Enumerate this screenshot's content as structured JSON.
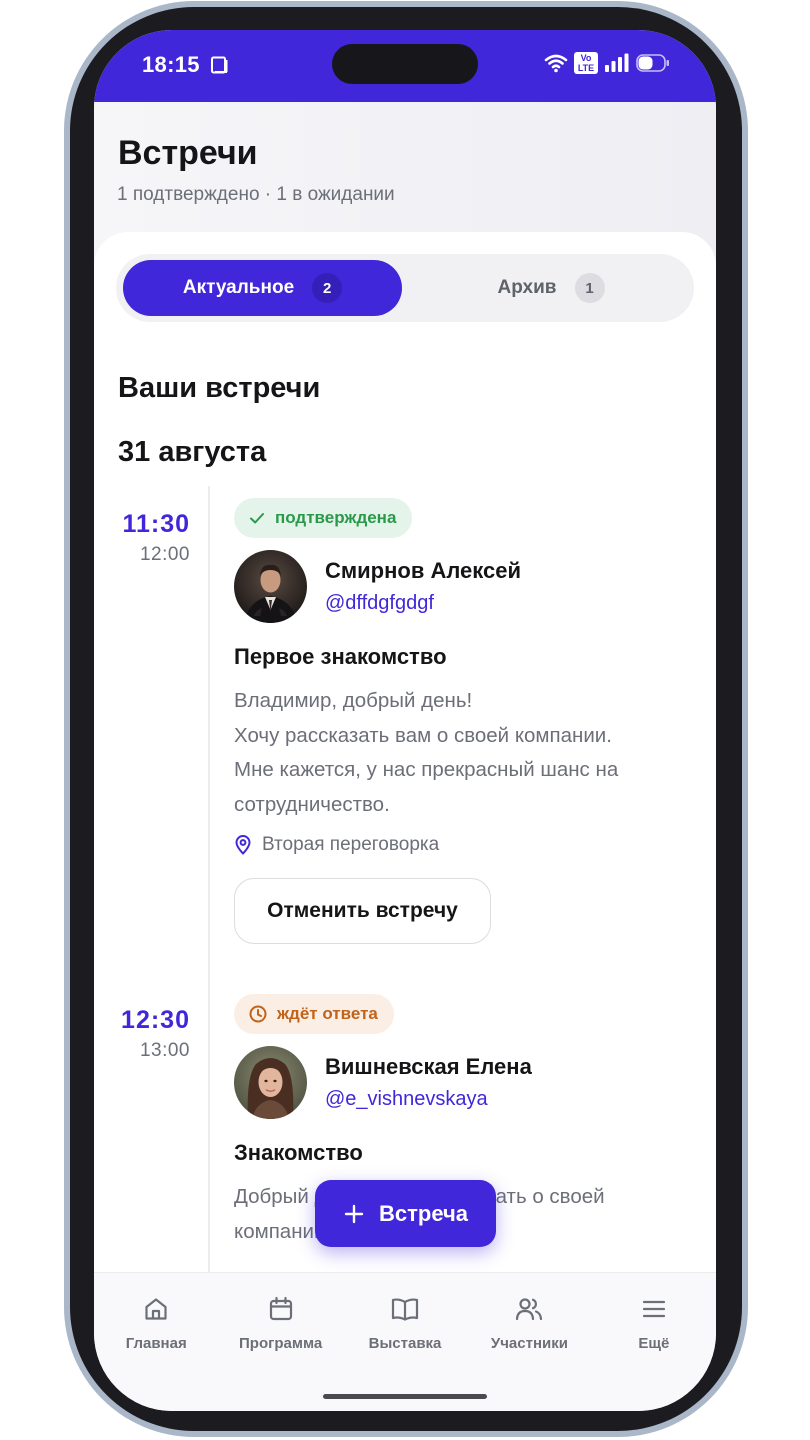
{
  "status_bar": {
    "time": "18:15",
    "volte_top": "Vo",
    "volte_bottom": "LTE"
  },
  "header": {
    "title": "Встречи",
    "subtitle": "1 подтверждено · 1 в ожидании"
  },
  "tabs": [
    {
      "label": "Актуальное",
      "count": "2",
      "active": true
    },
    {
      "label": "Архив",
      "count": "1",
      "active": false
    }
  ],
  "section_title": "Ваши встречи",
  "date_group": "31 августа",
  "meetings": [
    {
      "time_start": "11:30",
      "time_end": "12:00",
      "status": "подтверждена",
      "status_icon": "check-icon",
      "person_name": "Смирнов Алексей",
      "person_handle": "@dffdgfgdgf",
      "title": "Первое знакомство",
      "description_lines": [
        "Владимир, добрый день!",
        "Хочу рассказать вам о своей компании.",
        "Мне кажется, у нас прекрасный шанс на",
        "сотрудничество."
      ],
      "location": "Вторая переговорка",
      "cancel_label": "Отменить встречу"
    },
    {
      "time_start": "12:30",
      "time_end": "13:00",
      "status": "ждёт ответа",
      "status_icon": "clock-icon",
      "person_name": "Вишневская Елена",
      "person_handle": "@e_vishnevskaya",
      "title": "Знакомство",
      "description_lines": [
        "Добрый день! Хочу рассказать о своей",
        "компании."
      ]
    }
  ],
  "fab": {
    "label": "Встреча"
  },
  "bottom_nav": [
    {
      "label": "Главная",
      "icon": "home-icon"
    },
    {
      "label": "Программа",
      "icon": "calendar-icon"
    },
    {
      "label": "Выставка",
      "icon": "book-icon"
    },
    {
      "label": "Участники",
      "icon": "users-icon"
    },
    {
      "label": "Ещё",
      "icon": "menu-icon"
    }
  ],
  "colors": {
    "accent": "#4027d9",
    "confirmed": "#2a9a4a",
    "pending": "#c0631b"
  }
}
